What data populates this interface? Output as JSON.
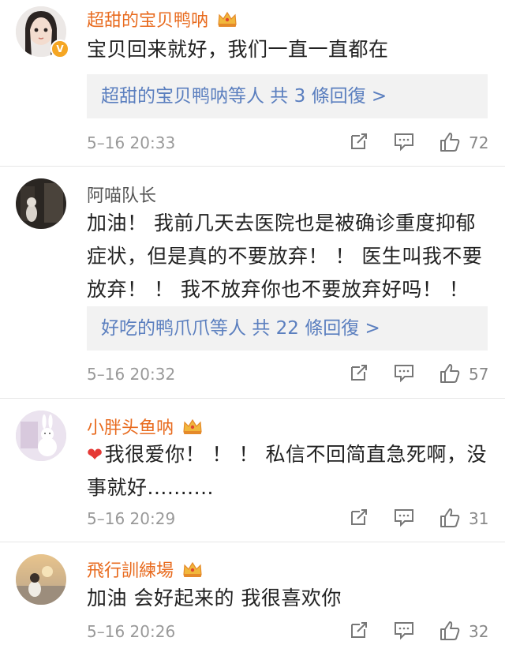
{
  "comments": [
    {
      "username": "超甜的宝贝鸭呐",
      "text": "宝贝回来就好，我们一直一直都在",
      "replies": "超甜的宝贝鸭呐等人 共 3 條回復 >",
      "time": "5–16 20:33",
      "likes": "72"
    },
    {
      "username": "阿喵队长",
      "text": "加油！ 我前几天去医院也是被确诊重度抑郁症状，但是真的不要放弃！ ！ 医生叫我不要放弃！ ！ 我不放弃你也不要放弃好吗！ ！",
      "replies": "好吃的鸭爪爪等人 共 22 條回復 >",
      "time": "5–16 20:32",
      "likes": "57"
    },
    {
      "username": "小胖头鱼呐",
      "text": "我很爱你！ ！ ！ 私信不回简直急死啊，没事就好..........",
      "time": "5–16 20:29",
      "likes": "31"
    },
    {
      "username": "飛行訓練場",
      "text": "加油 会好起来的 我很喜欢你",
      "time": "5–16 20:26",
      "likes": "32"
    }
  ],
  "icons": {
    "share": "share-icon",
    "comment": "comment-icon",
    "like": "thumbs-up-icon",
    "crown": "crown-badge-icon",
    "verified": "verified-badge-icon",
    "heart": "heart-icon"
  },
  "colors": {
    "username_vip": "#e86b1f",
    "username_plain": "#555555",
    "reply_link": "#5b7fbf",
    "reply_bg": "#f2f2f2",
    "meta_text": "#999999",
    "heart": "#e53935"
  }
}
